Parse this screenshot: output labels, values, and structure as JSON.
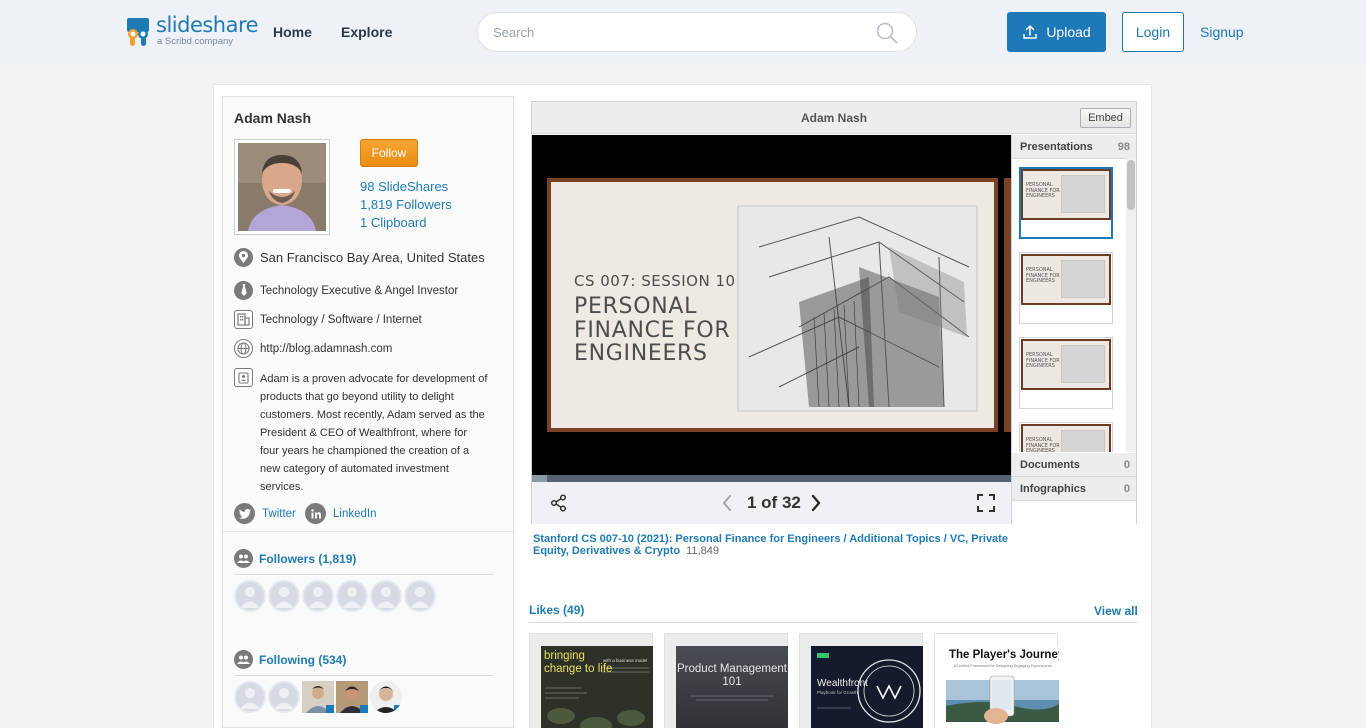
{
  "header": {
    "logo_text": "slideshare",
    "logo_sub": "a Scribd company",
    "nav": [
      "Home",
      "Explore"
    ],
    "search_placeholder": "Search",
    "upload_label": "Upload",
    "login_label": "Login",
    "signup_label": "Signup",
    "accent": "#1d79b7"
  },
  "profile": {
    "name": "Adam Nash",
    "follow_label": "Follow",
    "stats": {
      "slideshares": "98 SlideShares",
      "followers": "1,819 Followers",
      "clipboards": "1 Clipboard"
    },
    "location": "San Francisco Bay Area, United States",
    "occupation": "Technology Executive & Angel Investor",
    "industry": "Technology / Software / Internet",
    "website": "http://blog.adamnash.com",
    "bio": "Adam is a proven advocate for development of products that go beyond utility to delight customers. Most recently, Adam served as the President & CEO of Wealthfront, where for four years he championed the creation of a new category of automated investment services.",
    "social": {
      "twitter": "Twitter",
      "linkedin": "LinkedIn"
    },
    "followers_heading": "Followers (1,819)",
    "following_heading": "Following (534)"
  },
  "player": {
    "title": "Adam Nash",
    "embed_label": "Embed",
    "slide_session": "CS 007: SESSION 10",
    "slide_title": "PERSONAL\nFINANCE FOR\nENGINEERS",
    "page_indicator": "1 of 32",
    "progress": 0.031,
    "thumb_text": "PERSONAL\nFINANCE FOR\nENGINEERS",
    "sidebar": {
      "presentations_label": "Presentations",
      "presentations_count": "98",
      "documents_label": "Documents",
      "documents_count": "0",
      "infographics_label": "Infographics",
      "infographics_count": "0"
    }
  },
  "deck": {
    "title": "Stanford CS 007-10 (2021): Personal Finance for Engineers / Additional Topics / VC, Private Equity, Derivatives & Crypto",
    "views": "11,849"
  },
  "likes": {
    "heading": "Likes (49)",
    "view_all": "View all",
    "items": [
      {
        "title": "bringing change to life",
        "subtitle": "with a business model"
      },
      {
        "title": "Product Management 101"
      },
      {
        "title": "Wealthfront",
        "subtitle": "Playbook for Growth"
      },
      {
        "title": "The Player's Journey",
        "subtitle": "A Unified Framework for Designing Engaging Experiences"
      }
    ]
  }
}
